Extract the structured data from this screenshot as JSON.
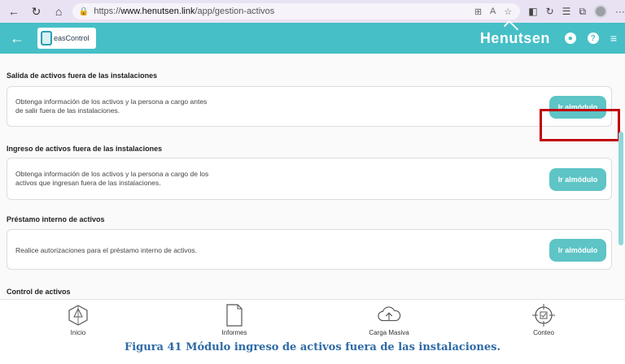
{
  "browser": {
    "url_prefix": "https://",
    "url_host": "www.henutsen.link",
    "url_path": "/app/gestion-activos"
  },
  "header": {
    "logo_text": "easControl",
    "brand": "Henutsen"
  },
  "sections": [
    {
      "title": "Salida de activos fuera de las instalaciones",
      "description_line1": "Obtenga información de los activos y la persona a cargo antes",
      "description_line2": "de salir fuera de las instalaciones.",
      "button": "Ir al módulo"
    },
    {
      "title": "Ingreso de activos fuera de las instalaciones",
      "description_line1": "Obtenga información de los activos y la persona a cargo de los",
      "description_line2": "activos que ingresan fuera de las  instalaciones.",
      "button": "Ir al módulo"
    },
    {
      "title": "Préstamo interno de activos",
      "description_line1": "Realice autorizaciones para el préstamo interno  de activos.",
      "description_line2": "",
      "button": "Ir al módulo"
    },
    {
      "title": "Control de activos"
    }
  ],
  "bottom_nav": [
    {
      "label": "Inicio",
      "icon": "home-icon"
    },
    {
      "label": "Informes",
      "icon": "document-icon"
    },
    {
      "label": "Carga Masiva",
      "icon": "cloud-upload-icon"
    },
    {
      "label": "Conteo",
      "icon": "target-check-icon"
    }
  ],
  "caption": "Figura 41 Módulo ingreso de activos fuera de las instalaciones.",
  "colors": {
    "accent": "#46bfc7",
    "button": "#5ec4c6",
    "highlight": "#c0000b",
    "caption": "#2e6aa6"
  }
}
